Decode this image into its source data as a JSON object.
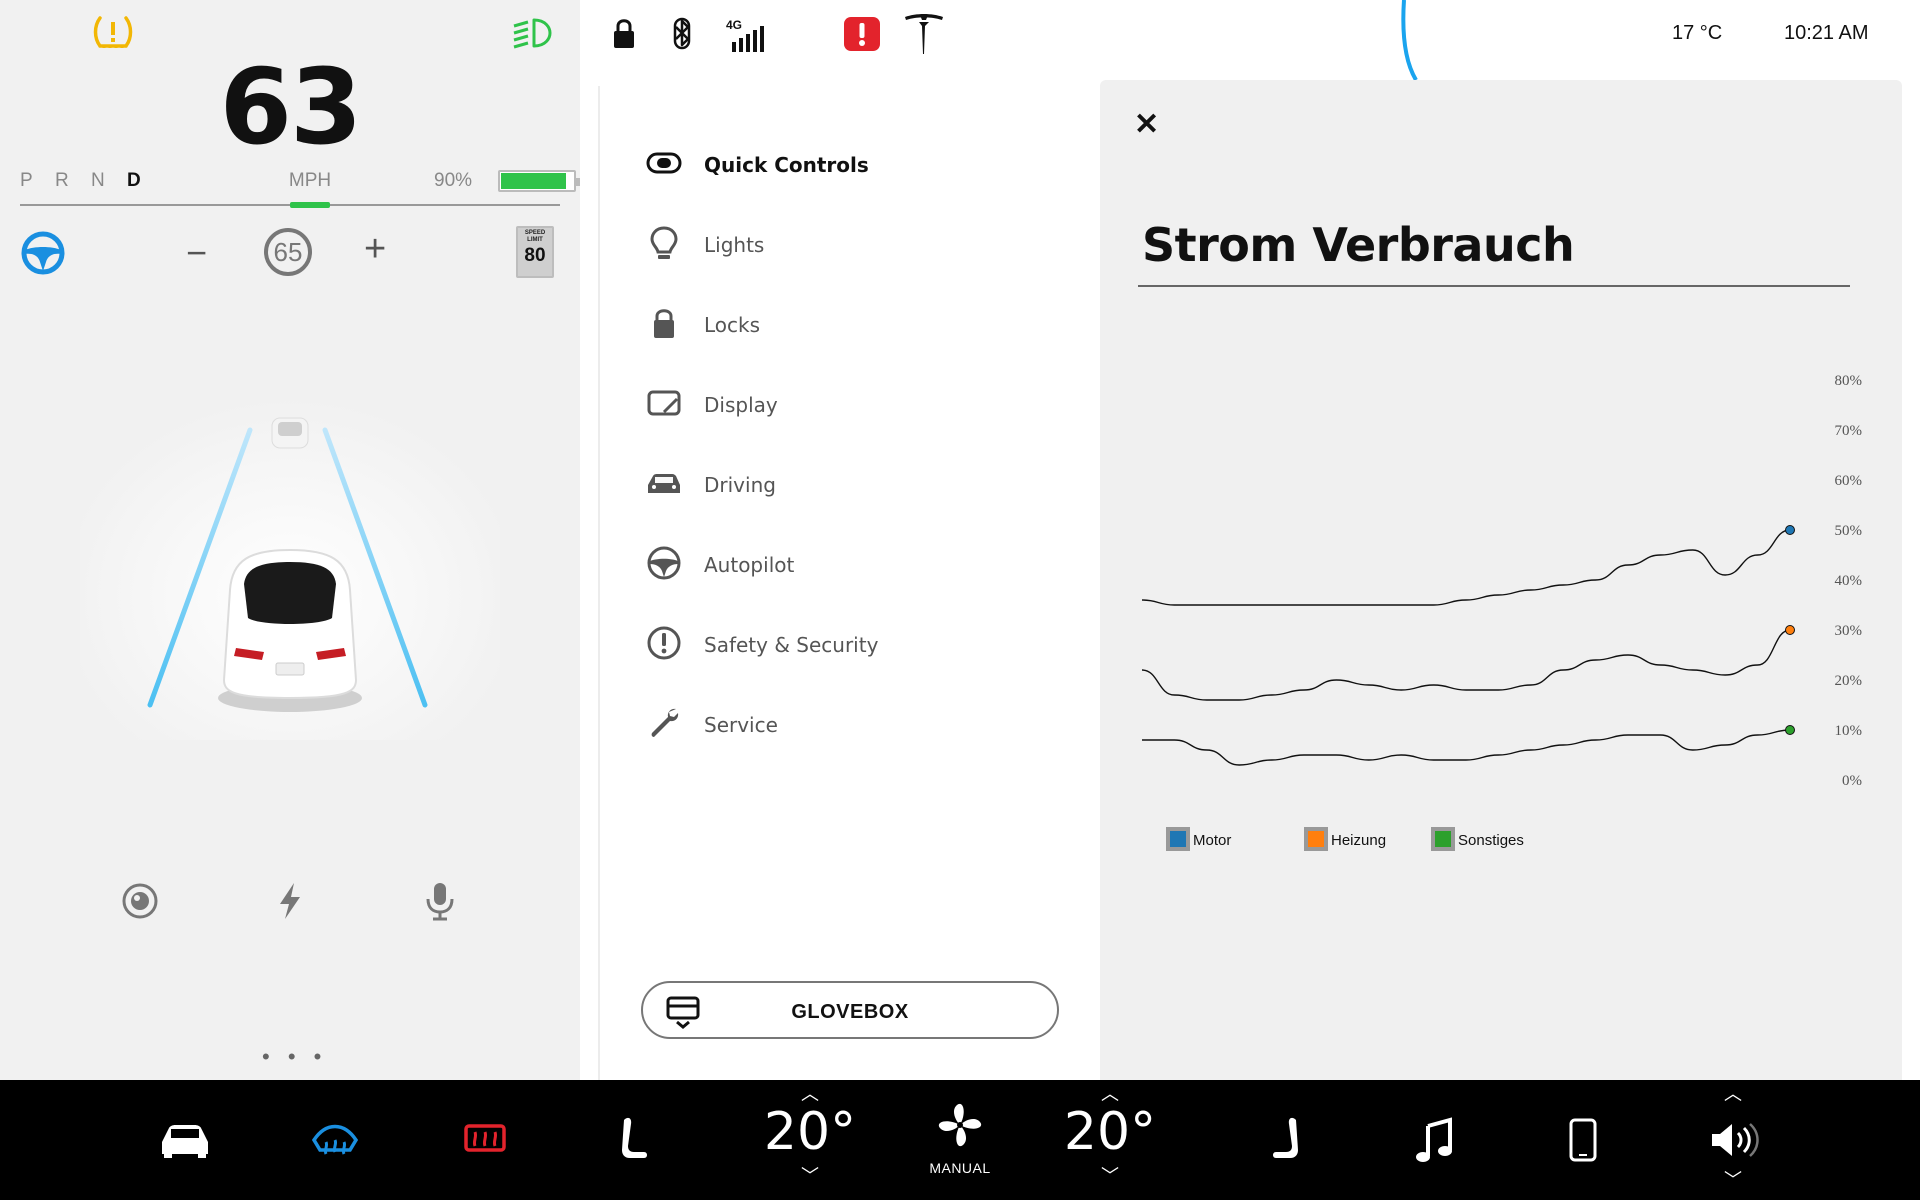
{
  "driver": {
    "speed": "63",
    "gears": [
      "P",
      "R",
      "N",
      "D"
    ],
    "active_gear": "D",
    "speed_unit": "MPH",
    "battery_percent_label": "90%",
    "battery_level": 0.9,
    "cruise_set_speed": "65",
    "speed_limit_label": "SPEED LIMIT",
    "speed_limit_value": "80"
  },
  "status_bar": {
    "network": "4G",
    "temperature": "17 °C",
    "time": "10:21 AM"
  },
  "menu": {
    "items": [
      {
        "label": "Quick Controls",
        "icon": "toggle-icon",
        "active": true
      },
      {
        "label": "Lights",
        "icon": "lightbulb-icon",
        "active": false
      },
      {
        "label": "Locks",
        "icon": "lock-icon",
        "active": false
      },
      {
        "label": "Display",
        "icon": "display-icon",
        "active": false
      },
      {
        "label": "Driving",
        "icon": "car-icon",
        "active": false
      },
      {
        "label": "Autopilot",
        "icon": "steering-wheel-icon",
        "active": false
      },
      {
        "label": "Safety & Security",
        "icon": "alert-circle-icon",
        "active": false
      },
      {
        "label": "Service",
        "icon": "wrench-icon",
        "active": false
      }
    ],
    "glovebox_label": "GLOVEBOX"
  },
  "panel": {
    "title": "Strom Verbrauch"
  },
  "chart_data": {
    "type": "line",
    "title": "Strom Verbrauch",
    "xlabel": "",
    "ylabel": "",
    "ylim": [
      0,
      80
    ],
    "y_ticks": [
      "0%",
      "10%",
      "20%",
      "30%",
      "40%",
      "50%",
      "60%",
      "70%",
      "80%"
    ],
    "legend_position": "bottom-left",
    "grid": false,
    "x": [
      0,
      1,
      2,
      3,
      4,
      5,
      6,
      7,
      8,
      9,
      10,
      11,
      12,
      13,
      14,
      15,
      16,
      17,
      18,
      19,
      20
    ],
    "series": [
      {
        "name": "Motor",
        "color": "#1f77b4",
        "values": [
          36,
          35,
          35,
          35,
          35,
          35,
          35,
          35,
          35,
          35,
          36,
          37,
          38,
          39,
          40,
          43,
          45,
          46,
          41,
          45,
          50
        ]
      },
      {
        "name": "Heizung",
        "color": "#ff7f0e",
        "values": [
          22,
          17,
          16,
          16,
          17,
          18,
          20,
          19,
          18,
          19,
          18,
          18,
          19,
          22,
          24,
          25,
          23,
          22,
          21,
          23,
          30
        ]
      },
      {
        "name": "Sonstiges",
        "color": "#2ca02c",
        "values": [
          8,
          8,
          6,
          3,
          4,
          5,
          5,
          4,
          5,
          4,
          4,
          5,
          6,
          7,
          8,
          9,
          9,
          6,
          7,
          9,
          10
        ]
      }
    ]
  },
  "climate": {
    "left_temp": "20°",
    "right_temp": "20°",
    "fan_label": "MANUAL"
  },
  "colors": {
    "accent_blue": "#1a8fe0",
    "battery_green": "#2fc34a",
    "tpms_yellow": "#f2b705",
    "alert_red": "#e3232c",
    "rear_defrost_red": "#e3232c"
  }
}
